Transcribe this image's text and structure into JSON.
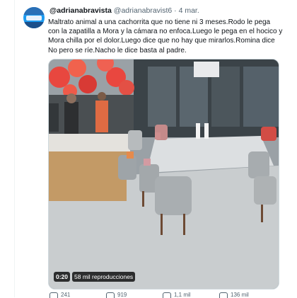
{
  "tweet": {
    "display_handle": "@adrianabravista",
    "account_handle": "@adrianabravist6",
    "date": "4 mar.",
    "text_lines": [
      "Maltrato animal a una cachorrita que no tiene ni 3 meses.Rodo le pega",
      "con la zapatilla a Mora y la cámara no enfoca.Luego le pega en el hocico y",
      "Mora chilla por el dolor.Luego dice que no hay que mirarlos.Romina dice",
      "No pero se ríe.Nacho le dice basta al padre."
    ]
  },
  "video": {
    "duration": "0:20",
    "views": "58 mil reproducciones"
  },
  "actions": {
    "reply_count": "241",
    "retweet_count": "919",
    "like_count": "1,1 mil",
    "view_count": "136 mil"
  },
  "colors": {
    "accent": "#1d9bf0",
    "text": "#0f1419",
    "secondary": "#536471",
    "border": "#cfd9de"
  },
  "icons": [
    "avatar",
    "reply-icon",
    "retweet-icon",
    "like-icon",
    "views-icon"
  ]
}
